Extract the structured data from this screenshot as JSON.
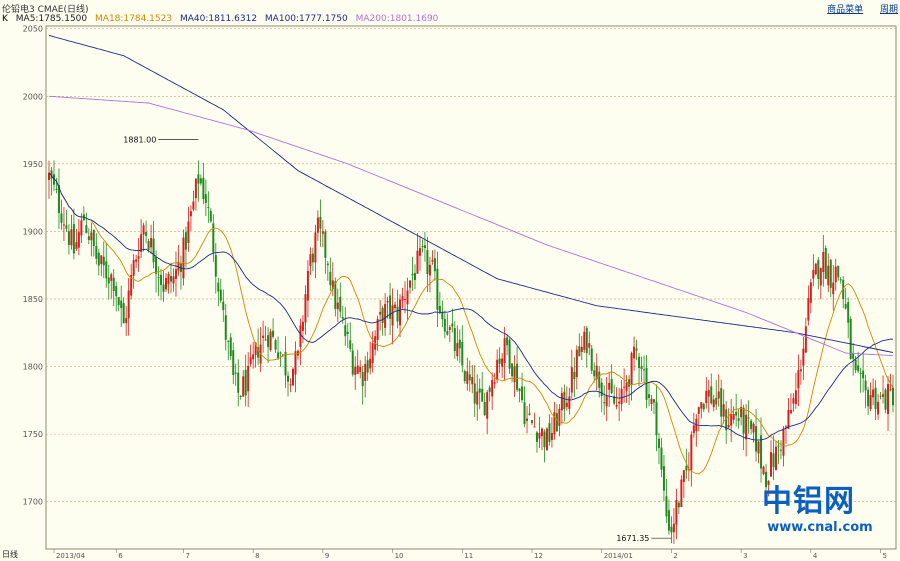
{
  "header": {
    "title": "伦铅电3 CMAE(日线)",
    "links": [
      "商品菜单",
      "周期"
    ]
  },
  "legend": {
    "k_label": "K",
    "items": [
      {
        "text": "MA5:1785.1500",
        "color": "#202020"
      },
      {
        "text": "MA18:1784.1523",
        "color": "#d08800"
      },
      {
        "text": "MA40:1811.6312",
        "color": "#1a2a8a"
      },
      {
        "text": "MA100:1777.1750",
        "color": "#1a2a8a"
      },
      {
        "text": "MA200:1801.1690",
        "color": "#b070e0"
      }
    ]
  },
  "footer": {
    "period_label": "日线",
    "x_labels": [
      "2013/04",
      "6",
      "7",
      "8",
      "9",
      "10",
      "11",
      "12",
      "2014/01",
      "2",
      "3",
      "4",
      "5"
    ]
  },
  "annotations": {
    "high": "1881.00",
    "low": "1671.35"
  },
  "logo": {
    "name": "中铝网",
    "url": "www.cnal.com"
  },
  "colors": {
    "background": "#fefef0",
    "up_candle": "#d32020",
    "down_candle": "#1e8a1e",
    "grid": "#c8a870",
    "axis_text": "#555555"
  },
  "chart_data": {
    "type": "candlestick",
    "ylim": [
      1665,
      2052
    ],
    "yticks": [
      2050,
      2000,
      1950,
      1900,
      1850,
      1800,
      1750,
      1700
    ],
    "candle_count": 210,
    "close_path": [
      [
        0,
        1940
      ],
      [
        6,
        1910
      ],
      [
        10,
        1885
      ],
      [
        14,
        1910
      ],
      [
        20,
        1875
      ],
      [
        26,
        1865
      ],
      [
        30,
        1830
      ],
      [
        34,
        1875
      ],
      [
        38,
        1905
      ],
      [
        40,
        1895
      ],
      [
        46,
        1860
      ],
      [
        50,
        1865
      ],
      [
        54,
        1885
      ],
      [
        58,
        1920
      ],
      [
        60,
        1940
      ],
      [
        63,
        1925
      ],
      [
        66,
        1890
      ],
      [
        70,
        1835
      ],
      [
        74,
        1790
      ],
      [
        76,
        1780
      ],
      [
        80,
        1790
      ],
      [
        84,
        1815
      ],
      [
        88,
        1825
      ],
      [
        92,
        1815
      ],
      [
        96,
        1795
      ],
      [
        100,
        1805
      ],
      [
        104,
        1870
      ],
      [
        108,
        1900
      ],
      [
        112,
        1880
      ],
      [
        114,
        1855
      ],
      [
        118,
        1830
      ],
      [
        122,
        1805
      ],
      [
        126,
        1795
      ],
      [
        130,
        1815
      ],
      [
        134,
        1840
      ],
      [
        136,
        1840
      ],
      [
        140,
        1840
      ],
      [
        144,
        1860
      ],
      [
        148,
        1875
      ],
      [
        150,
        1880
      ],
      [
        154,
        1870
      ],
      [
        156,
        1850
      ],
      [
        160,
        1830
      ],
      [
        164,
        1810
      ],
      [
        168,
        1790
      ],
      [
        172,
        1775
      ],
      [
        174,
        1770
      ],
      [
        176,
        1780
      ],
      [
        180,
        1805
      ],
      [
        184,
        1815
      ],
      [
        188,
        1790
      ],
      [
        190,
        1775
      ],
      [
        192,
        1760
      ],
      [
        196,
        1755
      ],
      [
        198,
        1750
      ],
      [
        200,
        1745
      ],
      [
        204,
        1760
      ],
      [
        208,
        1780
      ],
      [
        210,
        1790
      ],
      [
        212,
        1805
      ],
      [
        216,
        1820
      ],
      [
        220,
        1795
      ],
      [
        224,
        1780
      ],
      [
        228,
        1770
      ],
      [
        230,
        1775
      ],
      [
        232,
        1790
      ],
      [
        236,
        1810
      ],
      [
        238,
        1805
      ],
      [
        240,
        1785
      ],
      [
        244,
        1760
      ],
      [
        246,
        1720
      ],
      [
        248,
        1690
      ],
      [
        250,
        1680
      ],
      [
        252,
        1695
      ],
      [
        256,
        1720
      ],
      [
        258,
        1745
      ],
      [
        260,
        1770
      ],
      [
        264,
        1780
      ],
      [
        268,
        1775
      ],
      [
        272,
        1760
      ],
      [
        276,
        1765
      ],
      [
        280,
        1755
      ],
      [
        284,
        1745
      ],
      [
        286,
        1730
      ],
      [
        288,
        1720
      ],
      [
        292,
        1735
      ],
      [
        296,
        1755
      ],
      [
        300,
        1780
      ],
      [
        302,
        1805
      ],
      [
        304,
        1830
      ],
      [
        306,
        1855
      ],
      [
        308,
        1870
      ],
      [
        310,
        1880
      ],
      [
        312,
        1875
      ],
      [
        314,
        1868
      ],
      [
        316,
        1870
      ],
      [
        318,
        1865
      ],
      [
        320,
        1840
      ],
      [
        322,
        1810
      ],
      [
        324,
        1790
      ],
      [
        328,
        1778
      ],
      [
        330,
        1780
      ],
      [
        334,
        1775
      ],
      [
        338,
        1778
      ],
      [
        340,
        1782
      ]
    ],
    "high_point": {
      "index": 60,
      "value": 1881.0
    },
    "low_point": {
      "index": 250,
      "value": 1671.35
    },
    "series": [
      {
        "name": "MA5",
        "color": "#202020"
      },
      {
        "name": "MA18",
        "color": "#d08800"
      },
      {
        "name": "MA40",
        "color": "#1a2a8a"
      },
      {
        "name": "MA100",
        "color": "#1a2a8a"
      },
      {
        "name": "MA200",
        "color": "#b070e0"
      }
    ],
    "ma100": [
      [
        0,
        2045
      ],
      [
        30,
        2030
      ],
      [
        70,
        1990
      ],
      [
        100,
        1945
      ],
      [
        140,
        1905
      ],
      [
        180,
        1865
      ],
      [
        220,
        1845
      ],
      [
        260,
        1835
      ],
      [
        300,
        1825
      ],
      [
        340,
        1810
      ]
    ],
    "ma200": [
      [
        0,
        2000
      ],
      [
        40,
        1995
      ],
      [
        80,
        1975
      ],
      [
        120,
        1950
      ],
      [
        160,
        1920
      ],
      [
        200,
        1890
      ],
      [
        240,
        1865
      ],
      [
        280,
        1840
      ],
      [
        320,
        1810
      ],
      [
        340,
        1808
      ]
    ],
    "x_axis": "dates",
    "grid": true
  }
}
